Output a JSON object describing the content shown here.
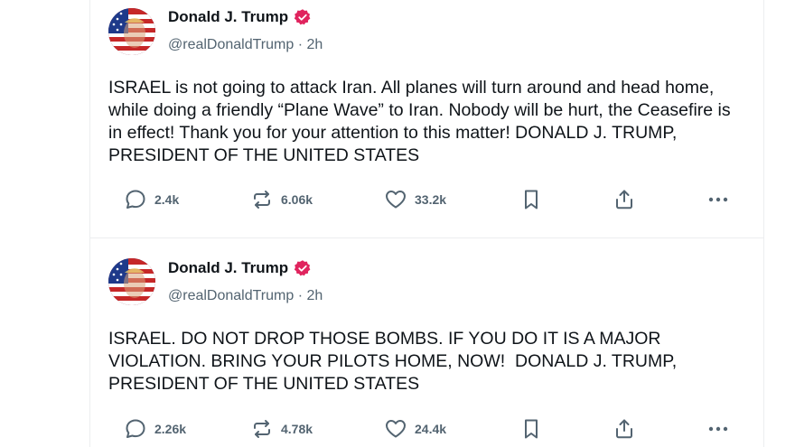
{
  "posts": [
    {
      "author": "Donald J. Trump",
      "handle": "@realDonaldTrump",
      "time": "2h",
      "text": "ISRAEL is not going to attack Iran. All planes will turn around and head home, while doing a friendly “Plane Wave” to Iran. Nobody will be hurt, the Ceasefire is in effect! Thank you for your attention to this matter! DONALD J. TRUMP, PRESIDENT OF THE UNITED STATES",
      "replies": "2.4k",
      "reposts": "6.06k",
      "likes": "33.2k"
    },
    {
      "author": "Donald J. Trump",
      "handle": "@realDonaldTrump",
      "time": "2h",
      "text": "ISRAEL. DO NOT DROP THOSE BOMBS. IF YOU DO IT IS A MAJOR VIOLATION. BRING YOUR PILOTS HOME, NOW!  DONALD J. TRUMP, PRESIDENT OF THE UNITED STATES",
      "replies": "2.26k",
      "reposts": "4.78k",
      "likes": "24.4k"
    }
  ],
  "separator": " · ",
  "icons": {
    "reply": "speech-bubble-icon",
    "repost": "repost-arrows-icon",
    "like": "heart-icon",
    "bookmark": "bookmark-icon",
    "share": "share-upload-icon",
    "more": "more-dots-icon",
    "verified": "verified-badge-icon"
  },
  "colors": {
    "verified": "#e0245e",
    "meta": "#536471",
    "text": "#0f1419"
  }
}
